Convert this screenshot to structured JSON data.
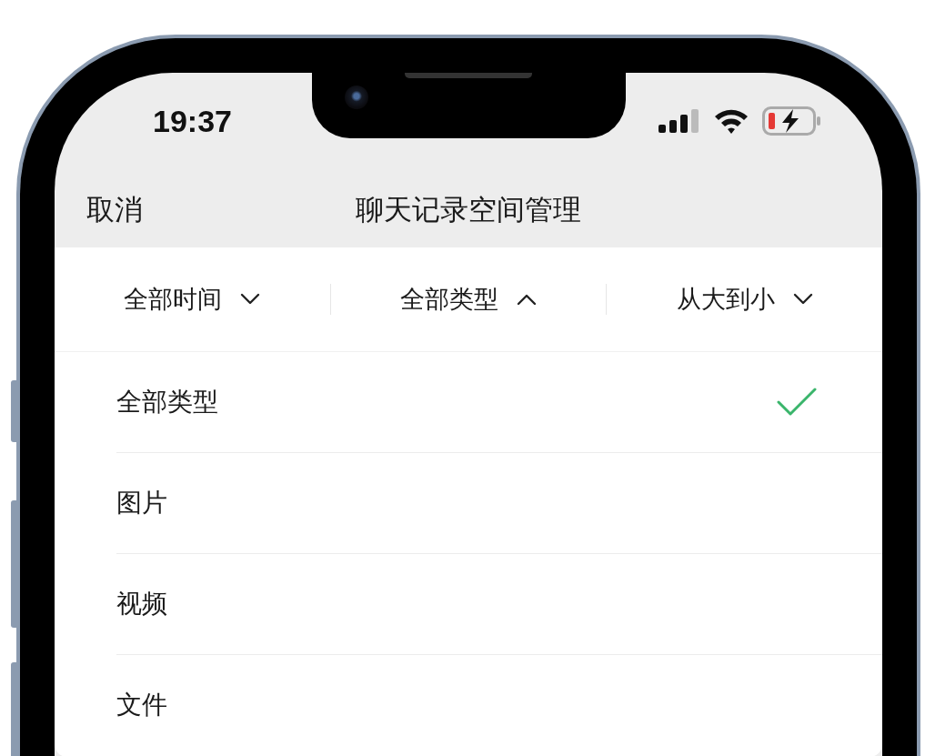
{
  "status_bar": {
    "time": "19:37"
  },
  "nav_bar": {
    "cancel": "取消",
    "title": "聊天记录空间管理"
  },
  "filters": [
    {
      "label": "全部时间",
      "expanded": false
    },
    {
      "label": "全部类型",
      "expanded": true
    },
    {
      "label": "从大到小",
      "expanded": false
    }
  ],
  "dropdown_items": [
    {
      "label": "全部类型",
      "selected": true
    },
    {
      "label": "图片",
      "selected": false
    },
    {
      "label": "视频",
      "selected": false
    },
    {
      "label": "文件",
      "selected": false
    }
  ]
}
